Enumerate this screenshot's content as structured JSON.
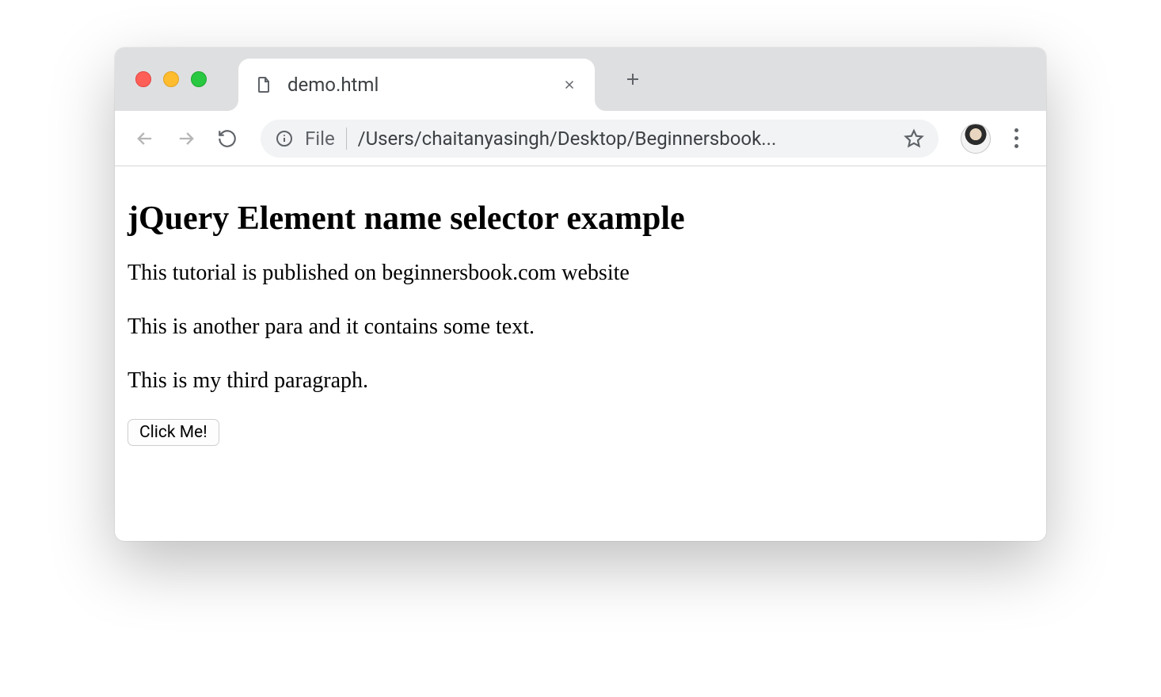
{
  "browser": {
    "tab": {
      "title": "demo.html"
    },
    "addressbar": {
      "scheme_label": "File",
      "url_display": "/Users/chaitanyasingh/Desktop/Beginnersbook..."
    }
  },
  "page": {
    "heading": "jQuery Element name selector example",
    "paragraphs": [
      "This tutorial is published on beginnersbook.com website",
      "This is another para and it contains some text.",
      "This is my third paragraph."
    ],
    "button_label": "Click Me!"
  }
}
